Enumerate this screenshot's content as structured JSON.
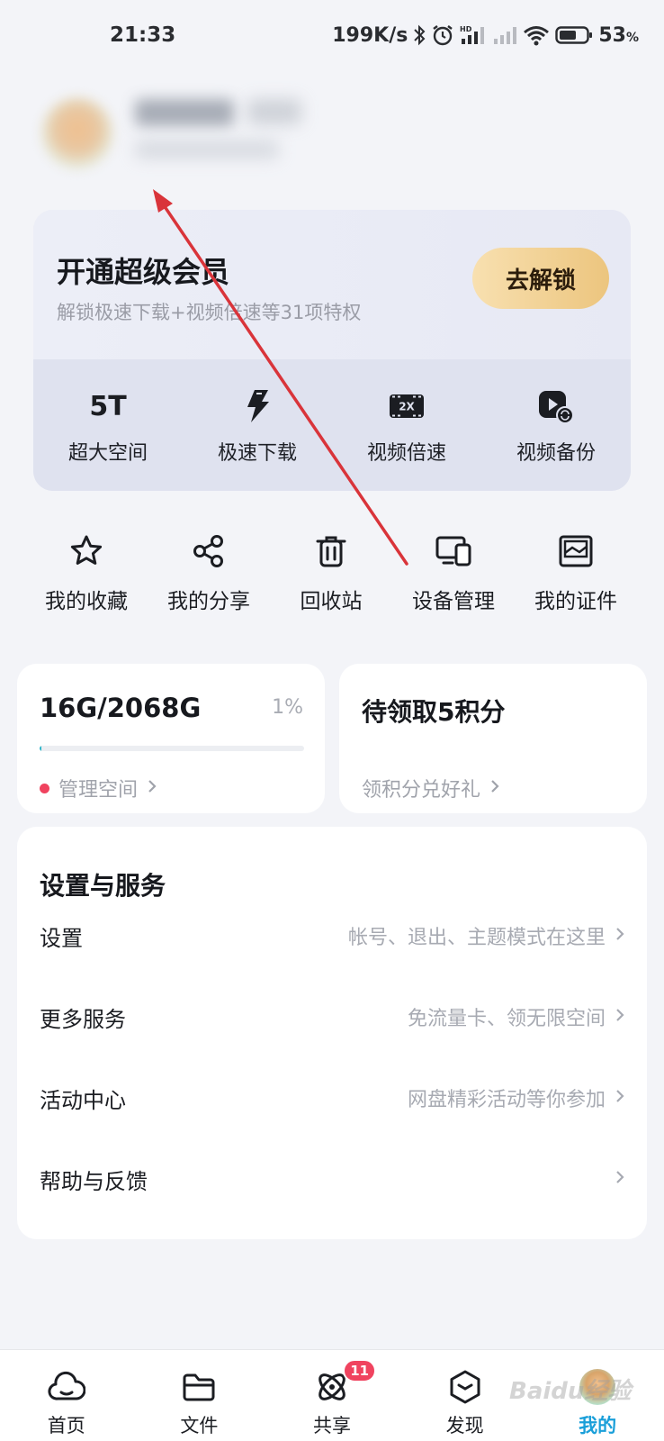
{
  "status_bar": {
    "time": "21:33",
    "speed": "199K/s",
    "battery_percent": "53",
    "battery_unit": "%",
    "icons": [
      "bluetooth-icon",
      "alarm-icon",
      "hd-signal-icon",
      "signal-icon",
      "wifi-icon",
      "battery-icon"
    ]
  },
  "vip": {
    "title": "开通超级会员",
    "subtitle": "解锁极速下载+视频倍速等31项特权",
    "unlock_label": "去解锁",
    "features": [
      {
        "icon": "5T",
        "label": "超大空间"
      },
      {
        "icon": "lightning-icon",
        "label": "极速下载"
      },
      {
        "icon": "2x-speed-icon",
        "label": "视频倍速"
      },
      {
        "icon": "video-backup-icon",
        "label": "视频备份"
      }
    ]
  },
  "quick_actions": [
    {
      "icon": "star-icon",
      "label": "我的收藏"
    },
    {
      "icon": "share-icon",
      "label": "我的分享"
    },
    {
      "icon": "trash-icon",
      "label": "回收站"
    },
    {
      "icon": "devices-icon",
      "label": "设备管理"
    },
    {
      "icon": "id-card-icon",
      "label": "我的证件"
    }
  ],
  "storage": {
    "value": "16G/2068G",
    "percent_label": "1%",
    "used_fraction": 0.008,
    "manage_label": "管理空间",
    "bar_color": "#2bb5c8"
  },
  "points": {
    "title": "待领取5积分",
    "link_label": "领积分兑好礼"
  },
  "settings": {
    "title": "设置与服务",
    "rows": [
      {
        "label": "设置",
        "hint": "帐号、退出、主题模式在这里"
      },
      {
        "label": "更多服务",
        "hint": "免流量卡、领无限空间"
      },
      {
        "label": "活动中心",
        "hint": "网盘精彩活动等你参加"
      },
      {
        "label": "帮助与反馈",
        "hint": ""
      }
    ]
  },
  "bottom_nav": {
    "items": [
      {
        "icon": "cloud-icon",
        "label": "首页"
      },
      {
        "icon": "folder-icon",
        "label": "文件"
      },
      {
        "icon": "atom-icon",
        "label": "共享",
        "badge": "11"
      },
      {
        "icon": "cube-icon",
        "label": "发现"
      },
      {
        "icon": "mascot-avatar",
        "label": "我的"
      }
    ],
    "active_color": "#1a9fd9"
  },
  "watermark": "Baidu经验",
  "colors": {
    "background": "#f3f4f8",
    "gold_button": "#ecc57e",
    "badge_red": "#f0435f",
    "annotation_arrow": "#d9343a"
  }
}
